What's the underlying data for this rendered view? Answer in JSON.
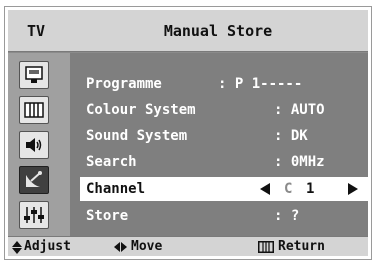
{
  "header": {
    "source": "TV",
    "title": "Manual Store"
  },
  "sidebar": {
    "items": [
      {
        "icon": "picture-icon"
      },
      {
        "icon": "menu-icon"
      },
      {
        "icon": "speaker-icon"
      },
      {
        "icon": "satellite-icon",
        "active": true
      },
      {
        "icon": "setup-sliders-icon"
      }
    ]
  },
  "menu": {
    "programme": {
      "label": "Programme",
      "value": ": P 1-----"
    },
    "colour_system": {
      "label": "Colour System",
      "value": ": AUTO"
    },
    "sound_system": {
      "label": "Sound System",
      "value": ": DK"
    },
    "search": {
      "label": "Search",
      "value": ":  0MHz"
    },
    "channel": {
      "label": "Channel",
      "prefix": "C",
      "value": "1"
    },
    "store": {
      "label": "Store",
      "value": ": ?"
    }
  },
  "footer": {
    "adjust": "Adjust",
    "move": "Move",
    "return": "Return"
  }
}
